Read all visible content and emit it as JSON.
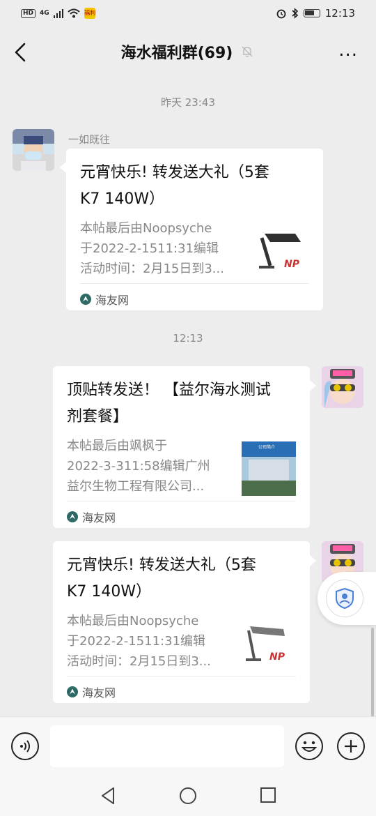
{
  "status_bar": {
    "hd_badge": "HD",
    "network": "4G",
    "app_badge": "福利",
    "time": "12:13"
  },
  "header": {
    "title": "海水福利群(69)",
    "more_label": "..."
  },
  "messages": [
    {
      "time": "昨天 23:43",
      "sender": "一如既往",
      "side": "left",
      "card": {
        "title": "元宵快乐! 转发送大礼（5套K7  140W）",
        "title_line1": "元宵快乐! 转发送大礼（5套",
        "title_line2": "K7  140W）",
        "desc_line1": "本帖最后由Noopsyche",
        "desc_line2": "于2022-2-1511:31编辑",
        "desc_line3": "活动时间：2月15日到3...",
        "source": "海友网",
        "thumb_caption": "NP"
      }
    },
    {
      "time": "12:13",
      "side": "right",
      "card": {
        "title_line1": "顶贴转发送！ 【益尔海水测试",
        "title_line2": "剂套餐】",
        "desc_line1": "本帖最后由飒枫于",
        "desc_line2": "2022-3-311:58编辑广州",
        "desc_line3": "益尔生物工程有限公司...",
        "source": "海友网",
        "thumb_caption": "公司简介"
      }
    },
    {
      "side": "right",
      "card": {
        "title_line1": "元宵快乐! 转发送大礼（5套",
        "title_line2": "K7  140W）",
        "desc_line1": "本帖最后由Noopsyche",
        "desc_line2": "于2022-2-1511:31编辑",
        "desc_line3": "活动时间：2月15日到3...",
        "source": "海友网",
        "thumb_caption": "NP"
      }
    }
  ],
  "colors": {
    "bg": "#ededed",
    "card": "#ffffff",
    "muted": "#888888"
  }
}
